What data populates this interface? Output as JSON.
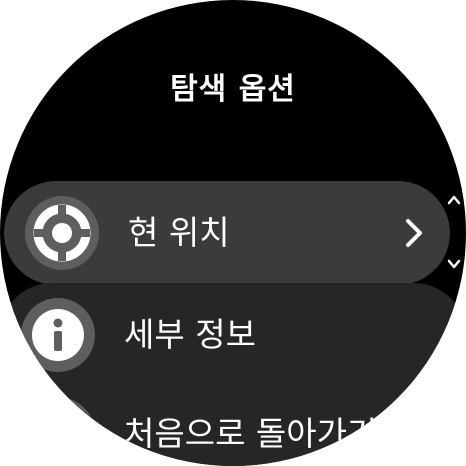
{
  "screen": {
    "title": "탐색 옵션"
  },
  "menu": {
    "items": [
      {
        "label": "현 위치",
        "icon": "location-target-icon",
        "selected": true,
        "has_chevron": true
      },
      {
        "label": "세부 정보",
        "icon": "info-icon",
        "selected": false
      },
      {
        "label": "처음으로 돌아가기",
        "icon": "back-icon",
        "selected": false
      }
    ]
  },
  "colors": {
    "background": "#000000",
    "item_bg": "#262626",
    "item_selected_bg": "#3b3b3b",
    "icon_circle": "#5e5e5e",
    "text": "#ffffff"
  }
}
